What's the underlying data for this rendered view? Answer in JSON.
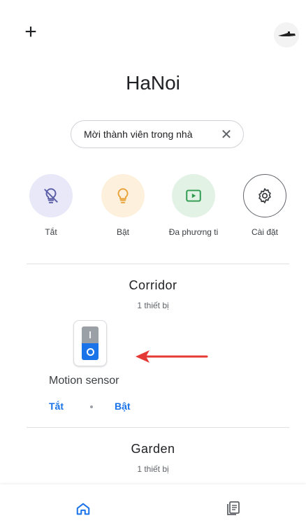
{
  "header": {
    "add_icon": "plus-icon",
    "add_label": "+",
    "avatar_icon": "account-avatar"
  },
  "home": {
    "title": "HaNoi"
  },
  "invite_chip": {
    "label": "Mời thành viên trong nhà",
    "close_label": "✕"
  },
  "quick_actions": [
    {
      "label": "Tắt",
      "icon": "light-off-icon",
      "color": "#5b5ea6",
      "bg": "#e8e8f8"
    },
    {
      "label": "Bật",
      "icon": "lightbulb-icon",
      "color": "#e8a33b",
      "bg": "#fdf0dc"
    },
    {
      "label": "Đa phương ti",
      "icon": "media-icon",
      "color": "#2e9b4f",
      "bg": "#e2f2e5"
    },
    {
      "label": "Cài đặt",
      "icon": "gear-icon",
      "color": "#3c4043",
      "bg": "#ffffff"
    }
  ],
  "rooms": [
    {
      "name": "Corridor",
      "count": "1 thiết bị",
      "device": {
        "name": "Motion sensor",
        "icon": "light-switch-icon",
        "off_label": "Tắt",
        "on_label": "Bật"
      }
    },
    {
      "name": "Garden",
      "count": "1 thiết bị"
    }
  ],
  "annotation": {
    "icon": "red-arrow",
    "color": "#e53935"
  },
  "bottom_nav": [
    {
      "icon": "home-icon",
      "active": true
    },
    {
      "icon": "feed-icon",
      "active": false
    }
  ],
  "colors": {
    "accent": "#1a73e8",
    "divider": "#e0e0e0"
  }
}
